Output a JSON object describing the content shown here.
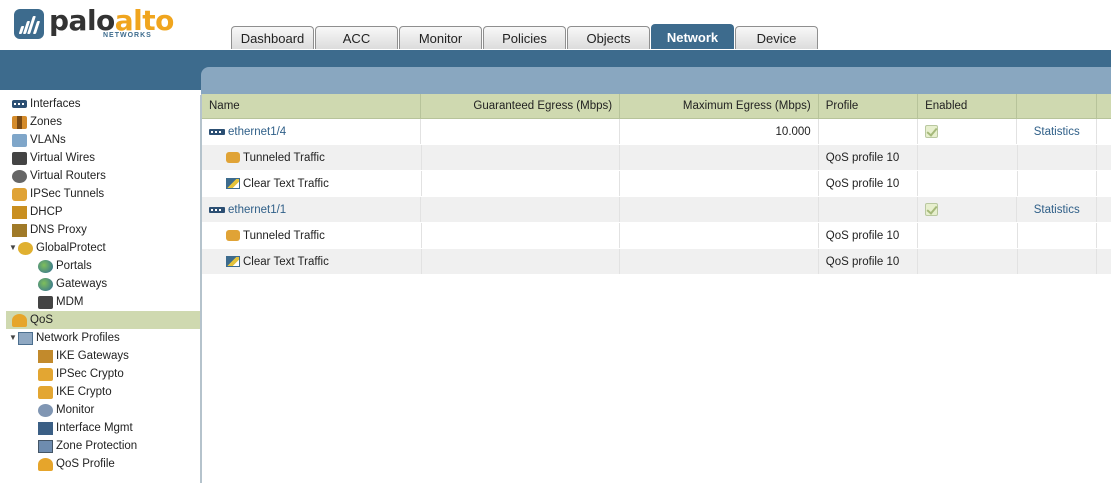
{
  "brand": {
    "name_part1": "palo",
    "name_part2": "alto",
    "sub": "NETWORKS"
  },
  "tabs": [
    {
      "label": "Dashboard",
      "active": false
    },
    {
      "label": "ACC",
      "active": false
    },
    {
      "label": "Monitor",
      "active": false
    },
    {
      "label": "Policies",
      "active": false
    },
    {
      "label": "Objects",
      "active": false
    },
    {
      "label": "Network",
      "active": true
    },
    {
      "label": "Device",
      "active": false
    }
  ],
  "sidebar": {
    "items": [
      {
        "label": "Interfaces",
        "icon": "interfaces-icon"
      },
      {
        "label": "Zones",
        "icon": "zones-icon"
      },
      {
        "label": "VLANs",
        "icon": "vlans-icon"
      },
      {
        "label": "Virtual Wires",
        "icon": "virtual-wires-icon"
      },
      {
        "label": "Virtual Routers",
        "icon": "virtual-routers-icon"
      },
      {
        "label": "IPSec Tunnels",
        "icon": "ipsec-tunnels-icon"
      },
      {
        "label": "DHCP",
        "icon": "dhcp-icon"
      },
      {
        "label": "DNS Proxy",
        "icon": "dns-proxy-icon"
      },
      {
        "label": "GlobalProtect",
        "icon": "globalprotect-icon"
      },
      {
        "label": "Portals",
        "icon": "portals-icon"
      },
      {
        "label": "Gateways",
        "icon": "gateways-icon"
      },
      {
        "label": "MDM",
        "icon": "mdm-icon"
      },
      {
        "label": "QoS",
        "icon": "qos-icon"
      },
      {
        "label": "Network Profiles",
        "icon": "network-profiles-icon"
      },
      {
        "label": "IKE Gateways",
        "icon": "ike-gateways-icon"
      },
      {
        "label": "IPSec Crypto",
        "icon": "ipsec-crypto-icon"
      },
      {
        "label": "IKE Crypto",
        "icon": "ike-crypto-icon"
      },
      {
        "label": "Monitor",
        "icon": "monitor-profile-icon"
      },
      {
        "label": "Interface Mgmt",
        "icon": "interface-mgmt-icon"
      },
      {
        "label": "Zone Protection",
        "icon": "zone-protection-icon"
      },
      {
        "label": "QoS Profile",
        "icon": "qos-profile-icon"
      }
    ],
    "selected": "QoS"
  },
  "grid": {
    "columns": {
      "name": "Name",
      "guaranteed": "Guaranteed Egress (Mbps)",
      "maximum": "Maximum Egress (Mbps)",
      "profile": "Profile",
      "enabled": "Enabled"
    },
    "rows": [
      {
        "name": "ethernet1/4",
        "guaranteed": "",
        "maximum": "10.000",
        "profile": "",
        "enabled": true,
        "stats": "Statistics"
      },
      {
        "name": "Tunneled Traffic",
        "guaranteed": "",
        "maximum": "",
        "profile": "QoS profile 10"
      },
      {
        "name": "Clear Text Traffic",
        "guaranteed": "",
        "maximum": "",
        "profile": "QoS profile 10"
      },
      {
        "name": "ethernet1/1",
        "guaranteed": "",
        "maximum": "",
        "profile": "",
        "enabled": true,
        "stats": "Statistics"
      },
      {
        "name": "Tunneled Traffic",
        "guaranteed": "",
        "maximum": "",
        "profile": "QoS profile 10"
      },
      {
        "name": "Clear Text Traffic",
        "guaranteed": "",
        "maximum": "",
        "profile": "QoS profile 10"
      }
    ]
  }
}
